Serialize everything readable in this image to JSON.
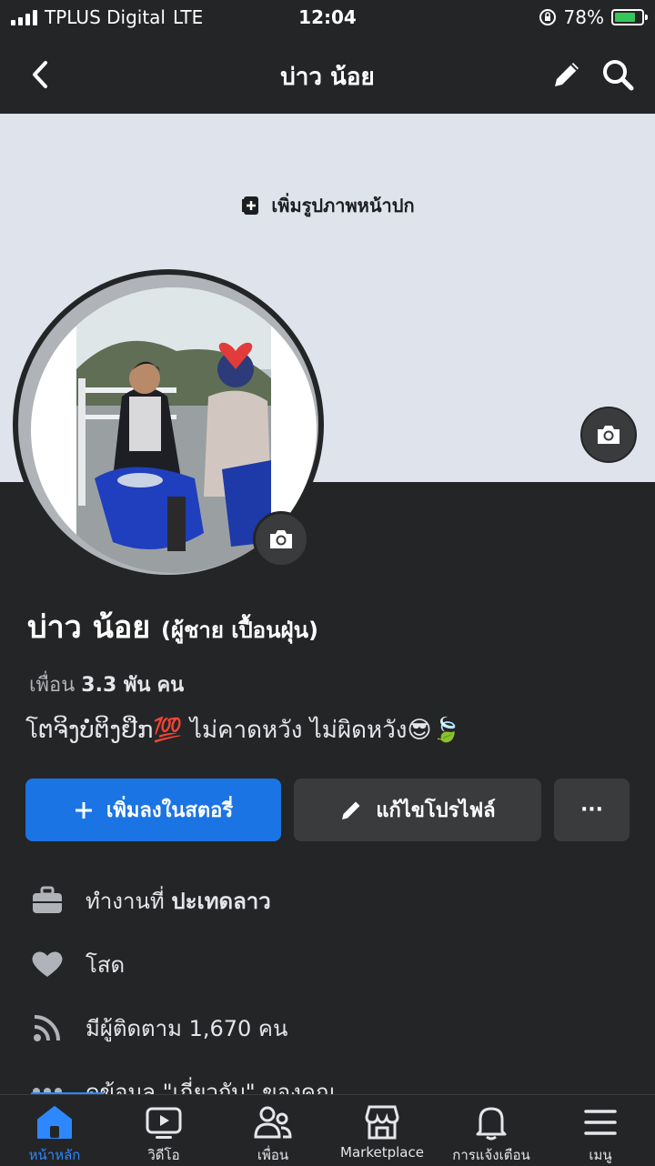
{
  "status_bar": {
    "carrier": "TPLUS Digital",
    "network": "LTE",
    "time": "12:04",
    "battery": "78%",
    "battery_level": 0.78
  },
  "nav": {
    "title": "บ่าว น้อย",
    "back_icon": "chevron-left-icon",
    "edit_icon": "pencil-icon",
    "search_icon": "search-icon"
  },
  "cover": {
    "add_cover_label": "เพิ่มรูปภาพหน้าปก"
  },
  "profile": {
    "name": "บ่าว น้อย",
    "alt_name": "(ผู้ชาย เปื้อนฝุ่น)",
    "friends_prefix": "เพื่อน",
    "friends_count": "3.3 พัน",
    "friends_suffix": "คน",
    "bio": "โຕຈິງບໍ່ຕິງຢືກ💯 ไม่คาดหวัง  ไม่ผิดหวัง😎🍃"
  },
  "actions": {
    "add_story": "เพิ่มลงในสตอรี่",
    "edit_profile": "แก้ไขโปรไฟล์",
    "more": "···"
  },
  "details": [
    {
      "icon": "briefcase-icon",
      "prefix": "ทำงานที่",
      "value": "ปะเทดลาว"
    },
    {
      "icon": "heart-icon",
      "prefix": "",
      "value": "โสด"
    },
    {
      "icon": "rss-icon",
      "prefix": "",
      "value": "มีผู้ติดตาม 1,670 คน"
    },
    {
      "icon": "more-icon",
      "prefix": "",
      "value": "ดูข้อมูล \"เกี่ยวกับ\" ของคุณ"
    }
  ],
  "tabs": [
    {
      "label": "หน้าหลัก",
      "icon": "home-icon",
      "active": true
    },
    {
      "label": "วิดีโอ",
      "icon": "video-icon",
      "active": false
    },
    {
      "label": "เพื่อน",
      "icon": "friends-icon",
      "active": false
    },
    {
      "label": "Marketplace",
      "icon": "marketplace-icon",
      "active": false
    },
    {
      "label": "การแจ้งเตือน",
      "icon": "bell-icon",
      "active": false
    },
    {
      "label": "เมนู",
      "icon": "menu-icon",
      "active": false
    }
  ],
  "colors": {
    "background": "#242526",
    "accent": "#1b74e4",
    "cover": "#dfe3ec"
  }
}
